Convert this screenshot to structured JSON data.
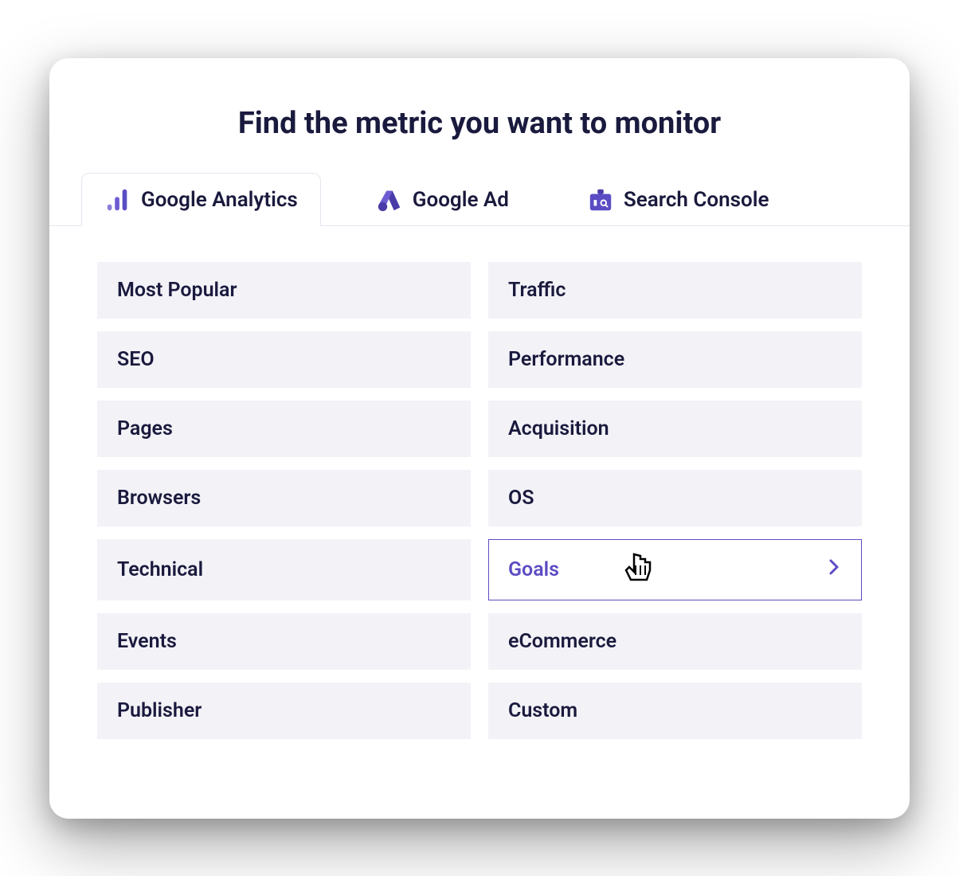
{
  "title": "Find the metric you want to monitor",
  "tabs": [
    {
      "label": "Google Analytics",
      "active": true
    },
    {
      "label": "Google Ad",
      "active": false
    },
    {
      "label": "Search Console",
      "active": false
    }
  ],
  "categories": {
    "left": [
      "Most Popular",
      "SEO",
      "Pages",
      "Browsers",
      "Technical",
      "Events",
      "Publisher"
    ],
    "right": [
      "Traffic",
      "Performance",
      "Acquisition",
      "OS",
      "Goals",
      "eCommerce",
      "Custom"
    ]
  },
  "hovered_category": "Goals",
  "colors": {
    "primary": "#5b4cc4",
    "text": "#1a1a3e",
    "category_bg": "#f3f2f7"
  }
}
